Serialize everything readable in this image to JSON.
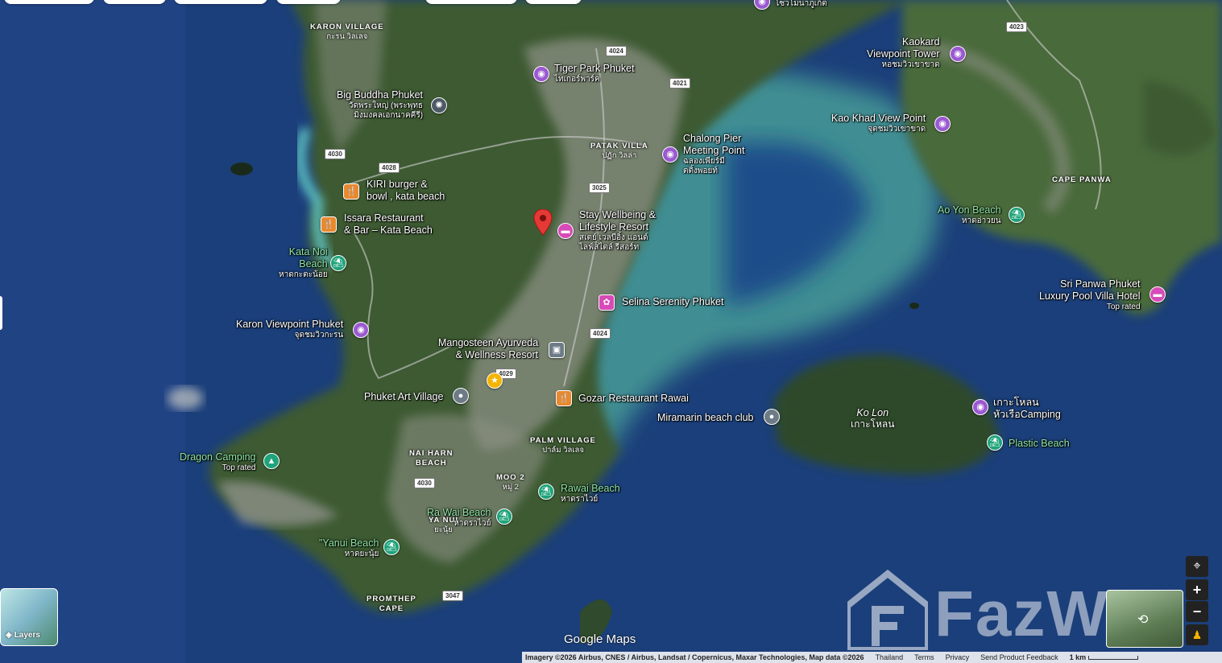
{
  "areas": {
    "karon_village": {
      "name": "KARON VILLAGE",
      "sub": "กะรน วิลเลจ"
    },
    "patak_villa": {
      "name": "PATAK VILLA",
      "sub": "ปฏัก วิลล่า"
    },
    "cape_panwa": {
      "name": "CAPE PANWA"
    },
    "palm_village": {
      "name": "PALM VILLAGE",
      "sub": "ปาล์ม วิลเลจ"
    },
    "nai_harn": {
      "name": "NAI HARN",
      "name2": "BEACH"
    },
    "moo2": {
      "name": "MOO 2",
      "sub": "หมู่ 2"
    },
    "ya_nui": {
      "name": "YA NUI",
      "sub": "ยะนุ้ย"
    },
    "promthep": {
      "name": "PROMTHEP",
      "name2": "CAPE"
    }
  },
  "island": {
    "name": "Ko Lon",
    "sub": "เกาะโหลน"
  },
  "places": {
    "tiger_park": {
      "name": "Tiger Park Phuket",
      "sub": "ไทเกอร์พาร์ค"
    },
    "big_buddha": {
      "name": "Big Buddha Phuket",
      "sub": "วัดพระใหญ่ (พระพุทธ",
      "sub2": "มิ่งมงคลเอกนาคคีรี)"
    },
    "kiri_burger": {
      "name": "KIRI burger &",
      "name2": "bowl , kata beach"
    },
    "issara": {
      "name": "Issara Restaurant",
      "name2": "& Bar – Kata Beach"
    },
    "kata_noi": {
      "name": "Kata Noi",
      "name2": "Beach",
      "sub": "หาดกะตะน้อย"
    },
    "karon_viewpoint": {
      "name": "Karon Viewpoint Phuket",
      "sub": "จุดชมวิวกะรน"
    },
    "chalong_pier": {
      "name": "Chalong Pier",
      "name2": "Meeting Point",
      "sub": "ฉลองเพียร์มี",
      "sub2": "ตติ้งพอยท์"
    },
    "stay_wellbeing": {
      "name": "Stay Wellbeing &",
      "name2": "Lifestyle Resort",
      "sub": "สเตย์ เวลบีอิ้ง แอนด์",
      "sub2": "ไลฟ์สไตล์ รีสอร์ท"
    },
    "selina": {
      "name": "Selina Serenity Phuket"
    },
    "mangosteen": {
      "name": "Mangosteen Ayurveda",
      "name2": "& Wellness Resort"
    },
    "phuket_art": {
      "name": "Phuket Art Village"
    },
    "gozar": {
      "name": "Gozar Restaurant Rawai"
    },
    "miramarin": {
      "name": "Miramarin beach club"
    },
    "dragon_camping": {
      "name": "Dragon Camping",
      "sub": "Top rated"
    },
    "rawai_beach": {
      "name": "Rawai Beach",
      "sub": "หาดราไวย์"
    },
    "ra_wai_beach": {
      "name": "Ra Wai Beach",
      "sub": "หาดราไวย์"
    },
    "yanui_beach": {
      "name": "\"Yanui Beach",
      "sub": "หาดยะนุ้ย"
    },
    "kaokard": {
      "name": "Kaokard",
      "name2": "Viewpoint Tower",
      "sub": "หอชมวิวเขาขาด"
    },
    "kao_khad": {
      "name": "Kao Khad View Point",
      "sub": "จุดชมวิวเขาขาด"
    },
    "ao_yon": {
      "name": "Ao Yon Beach",
      "sub": "หาดอ่าวยน"
    },
    "sri_panwa": {
      "name": "Sri Panwa Phuket",
      "name2": "Luxury Pool Villa Hotel",
      "sub": "Top rated"
    },
    "ko_lon_camping": {
      "name": "เกาะโหลน",
      "name2": "หัวเรือCamping"
    },
    "plastic_beach": {
      "name": "Plastic Beach"
    },
    "top_label": {
      "name": "โซวโมนาภูเก็ต"
    }
  },
  "roads": [
    "4024",
    "4023",
    "4021",
    "4030",
    "4028",
    "3025",
    "4024",
    "4029",
    "4030",
    "3047"
  ],
  "layers": {
    "label": "Layers"
  },
  "brand": {
    "google_maps": "Google Maps",
    "watermark": "FazWaz"
  },
  "footer": {
    "imagery": "Imagery ©2026 Airbus, CNES / Airbus, Landsat / Copernicus, Maxar Technologies, Map data ©2026",
    "country": "Thailand",
    "terms": "Terms",
    "privacy": "Privacy",
    "feedback": "Send Product Feedback",
    "scale": "1 km"
  },
  "colors": {
    "sea": "#1b3f7a",
    "shallow": "#3f8e93",
    "land": "#3d5a33",
    "urban": "#8a8f82",
    "attraction": "#9b59d0",
    "restaurant": "#e8892f",
    "beach": "#1fa37a",
    "hotel": "#d84ab8",
    "pin_red": "#e53935"
  }
}
